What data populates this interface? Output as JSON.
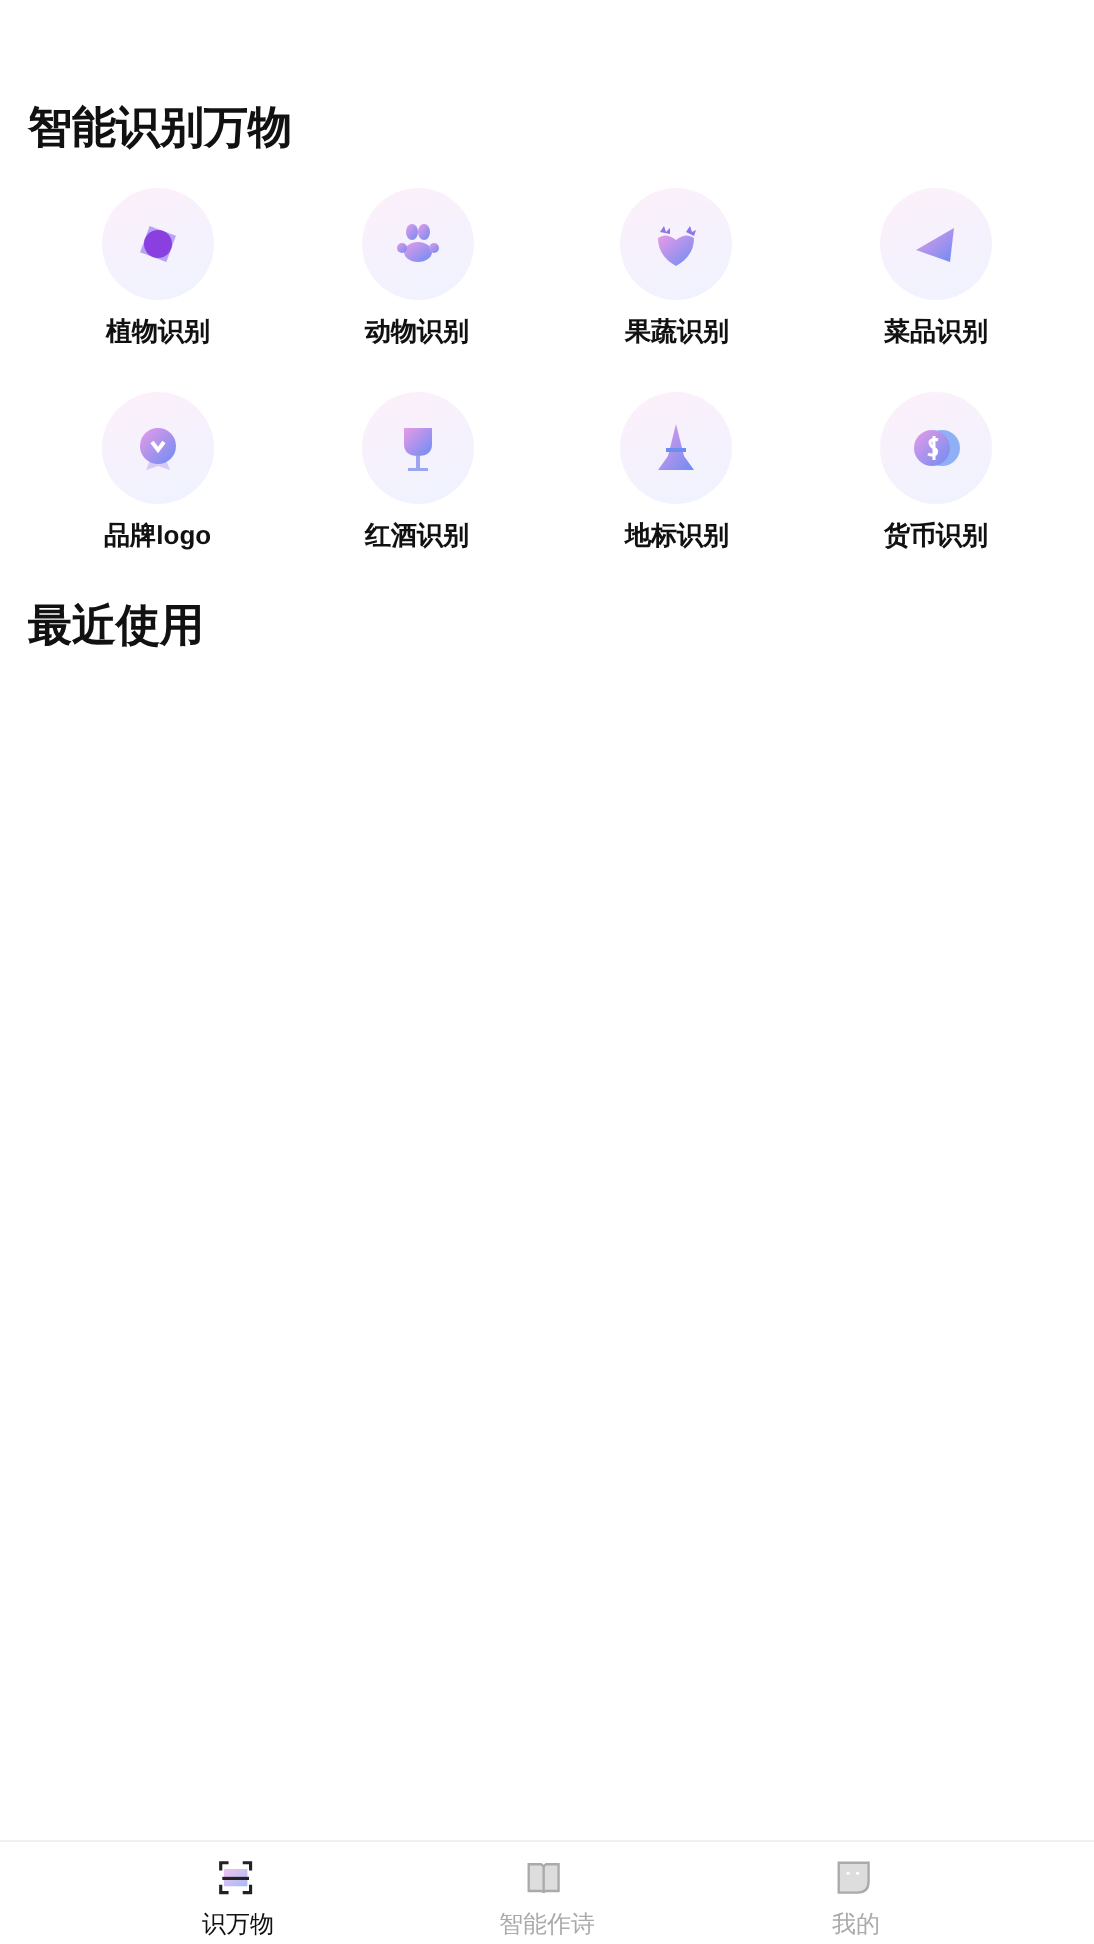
{
  "sections": [
    {
      "title": "智能识别万物",
      "items": [
        {
          "kind": "plant",
          "label": "植物识别"
        },
        {
          "kind": "animal",
          "label": "动物识别"
        },
        {
          "kind": "fruit",
          "label": "果蔬识别"
        },
        {
          "kind": "dish",
          "label": "菜品识别"
        },
        {
          "kind": "brand",
          "label": "品牌logo"
        },
        {
          "kind": "wine",
          "label": "红酒识别"
        },
        {
          "kind": "landmark",
          "label": "地标识别"
        },
        {
          "kind": "currency",
          "label": "货币识别"
        }
      ]
    },
    {
      "title": "最近使用"
    }
  ],
  "tab_bar": [
    {
      "kind": "scan",
      "label": "识万物",
      "selected": true
    },
    {
      "kind": "book",
      "label": "智能作诗",
      "selected": false
    },
    {
      "kind": "profile",
      "label": "我的",
      "selected": false
    }
  ]
}
